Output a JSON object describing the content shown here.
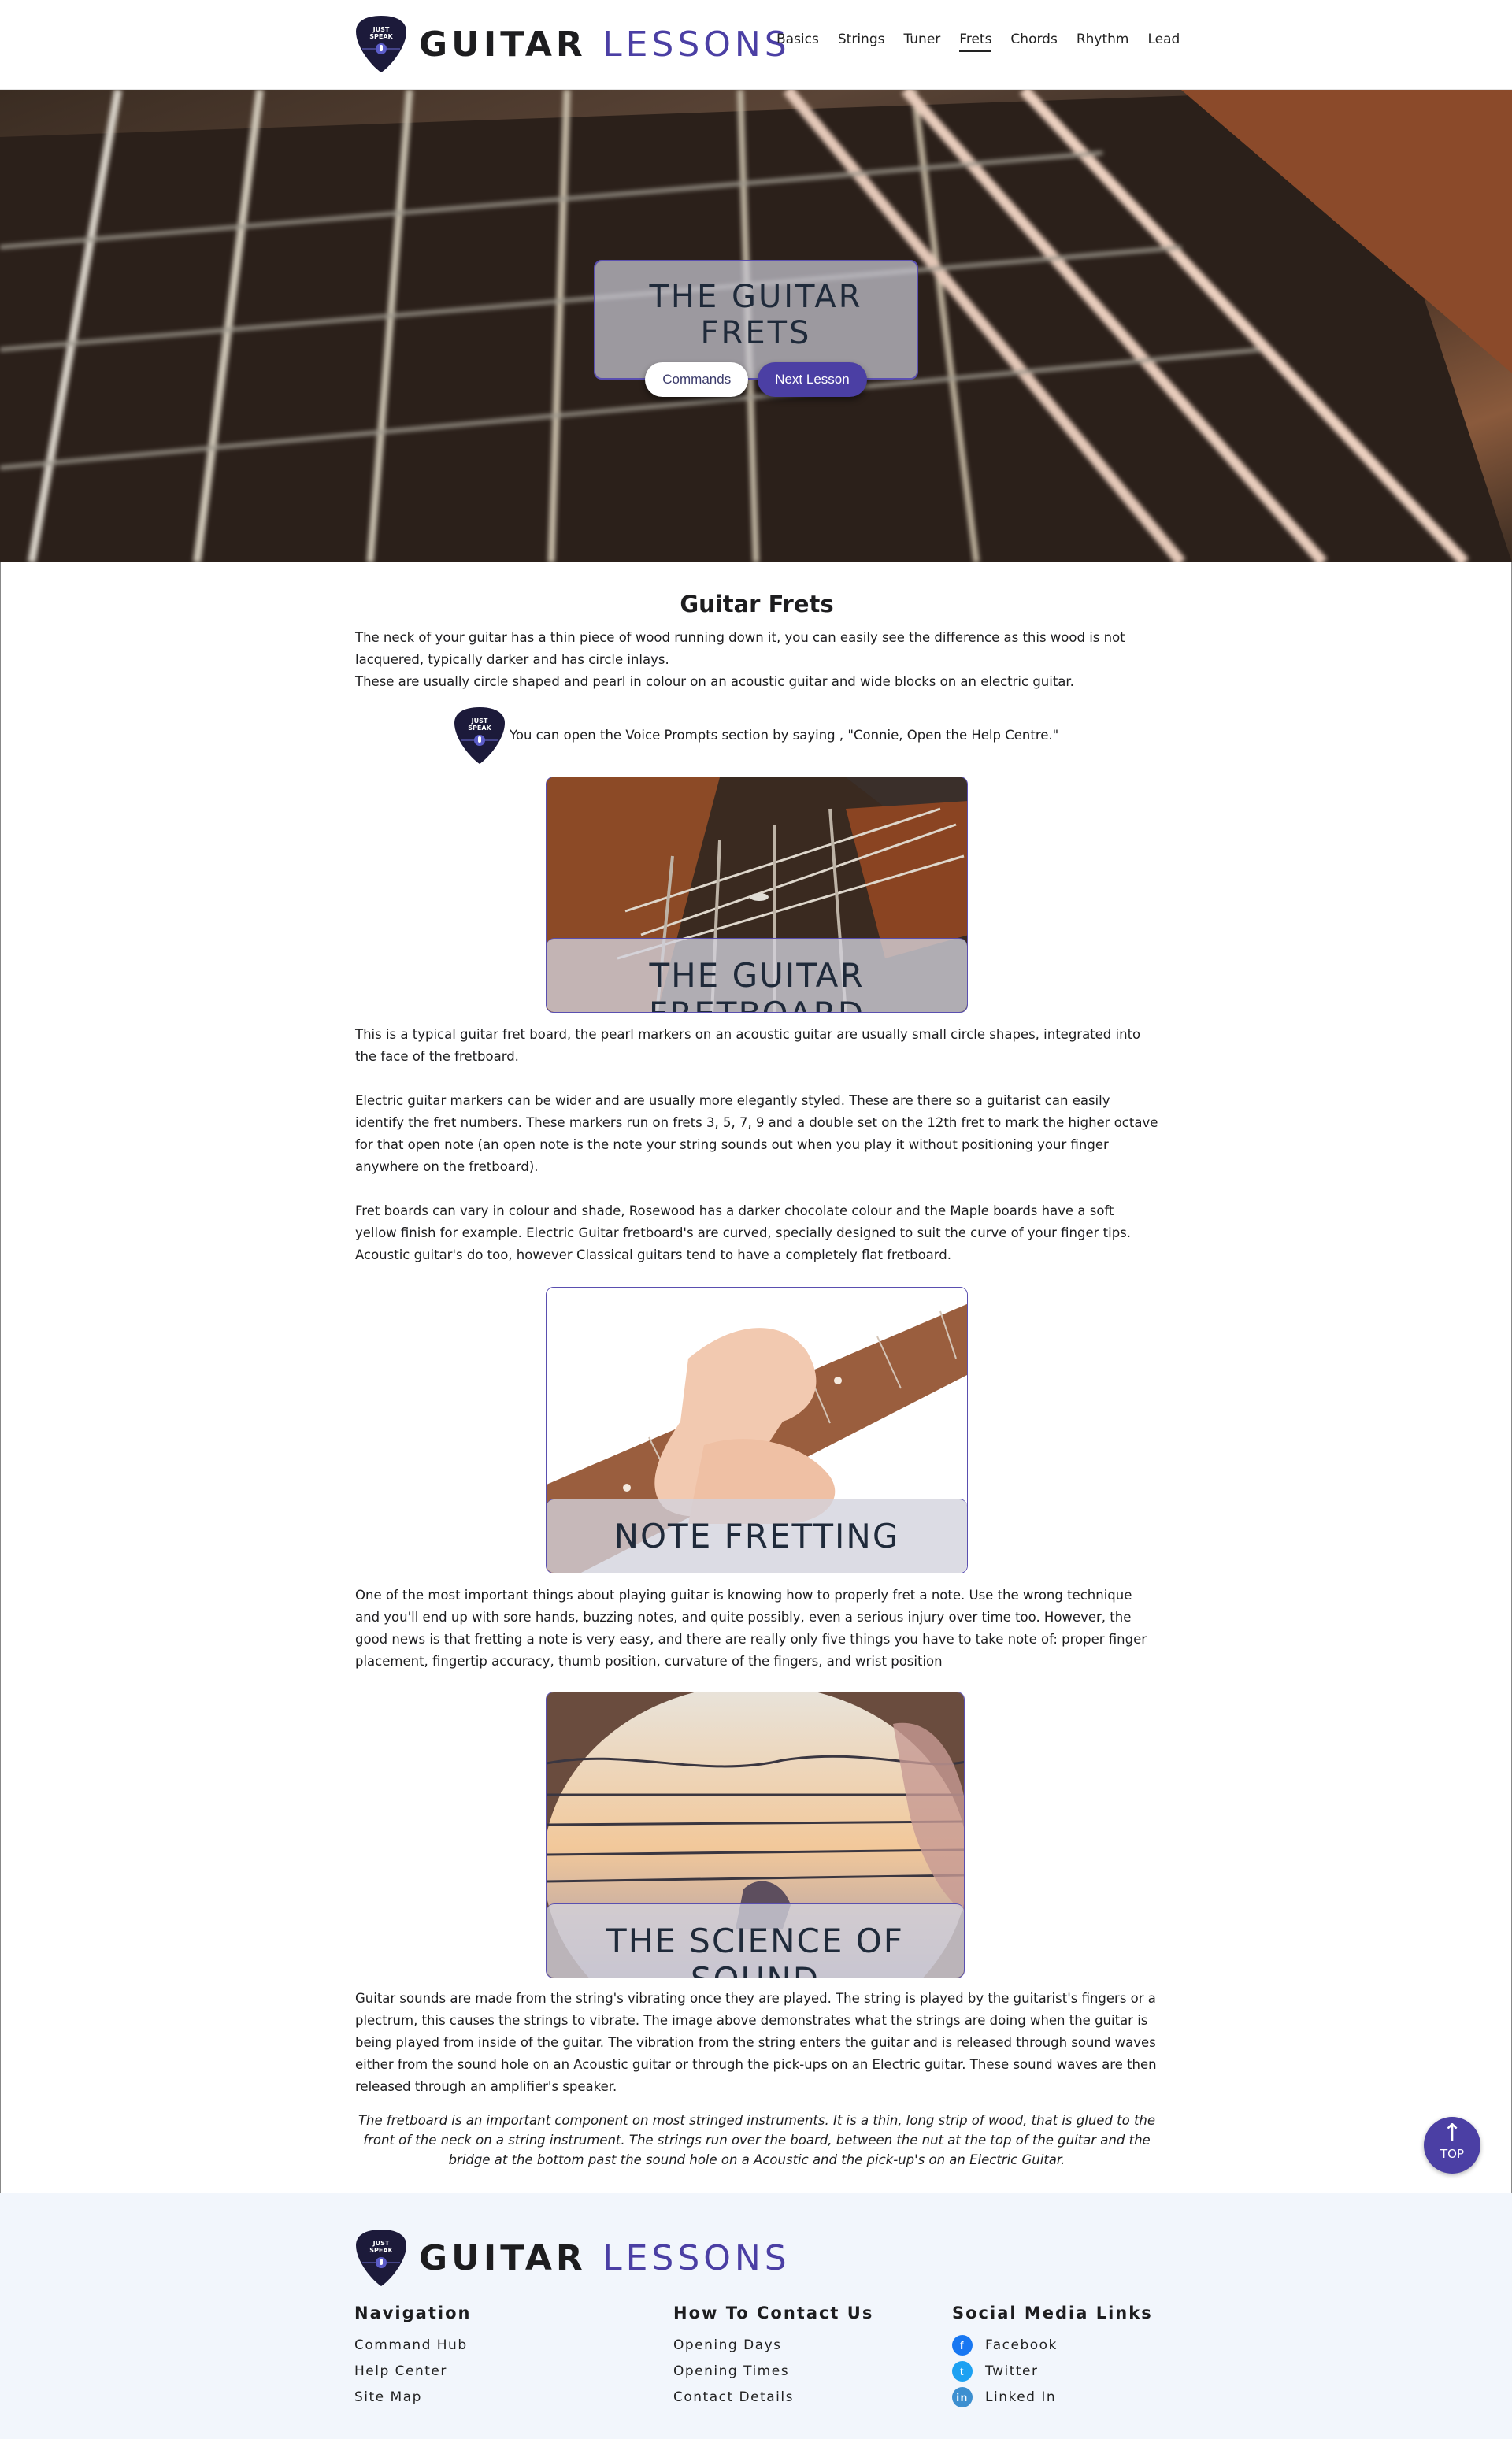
{
  "header": {
    "logo_pick_text": "JUST SPEAK",
    "brand_word1": "GUITAR",
    "brand_word2": "LESSONS",
    "nav": [
      "Basics",
      "Strings",
      "Tuner",
      "Frets",
      "Chords",
      "Rhythm",
      "Lead"
    ],
    "active_nav": "Frets"
  },
  "hero": {
    "title": "THE GUITAR FRETS",
    "btn_commands": "Commands",
    "btn_next": "Next Lesson"
  },
  "main": {
    "heading": "Guitar Frets",
    "intro_1": "The neck of your guitar has a thin piece of wood running down it, you can easily see the difference as this wood is not lacquered, typically darker and has circle inlays.",
    "intro_2": "These are usually circle shaped and pearl in colour on an acoustic guitar and wide blocks on an electric guitar.",
    "tip": "You can open the Voice Prompts section by saying , \"Connie, Open the Help Centre.\"",
    "card1_caption": "THE GUITAR FRETBOARD",
    "fretboard_p1": "This is a typical guitar fret board, the pearl markers on an acoustic guitar are usually small circle shapes, integrated into the face of the fretboard.",
    "fretboard_p2": "Electric guitar markers can be wider and are usually more elegantly styled. These are there so a guitarist can easily identify the fret numbers. These markers run on frets 3, 5, 7, 9 and a double set on the 12th fret to mark the higher octave for that open note (an open note is the note your string sounds out when you play it without positioning your finger anywhere on the fretboard).",
    "fretboard_p3": "Fret boards can vary in colour and shade, Rosewood has a darker chocolate colour and the Maple boards have a soft yellow finish for example. Electric Guitar fretboard's are curved, specially designed to suit the curve of your finger tips. Acoustic guitar's do too, however Classical guitars tend to have a completely flat fretboard.",
    "card2_caption": "NOTE FRETTING",
    "fretting_p": "One of the most important things about playing guitar is knowing how to properly fret a note. Use the wrong technique and you'll end up with sore hands, buzzing notes, and quite possibly, even a serious injury over time too. However, the good news is that fretting a note is very easy, and there are really only five things you have to take note of: proper finger placement, fingertip accuracy, thumb position, curvature of the fingers, and wrist position",
    "card3_caption": "THE SCIENCE OF SOUND",
    "sound_p": "Guitar sounds are made from the string's vibrating once they are played. The string is played by the guitarist's fingers or a plectrum, this causes the strings to vibrate. The image above demonstrates what the strings are doing when the guitar is being played from inside of the guitar. The vibration from the string enters the guitar and is released through sound waves either from the sound hole on an Acoustic guitar or through the pick-ups on an Electric guitar. These sound waves are then released through an amplifier's speaker.",
    "quote": "The fretboard is an important component on most stringed instruments. It is a thin, long strip of wood, that is glued to the front of the neck on a string instrument. The strings run over the board, between the nut at the top of the guitar and the bridge at the bottom past the sound hole on a Acoustic and the pick-up's on an Electric Guitar."
  },
  "top_button": "TOP",
  "footer": {
    "nav_heading": "Navigation",
    "nav_links": [
      "Command Hub",
      "Help Center",
      "Site Map"
    ],
    "contact_heading": "How To Contact Us",
    "contact_links": [
      "Opening Days",
      "Opening Times",
      "Contact Details"
    ],
    "social_heading": "Social Media Links",
    "social_links": [
      "Facebook",
      "Twitter",
      "Linked In"
    ],
    "social_colors": [
      "#1877f2",
      "#1da1f2",
      "#3d8fd0"
    ]
  },
  "colors": {
    "accent": "#4b3fa4",
    "footer_bg": "#f2f6fc"
  }
}
